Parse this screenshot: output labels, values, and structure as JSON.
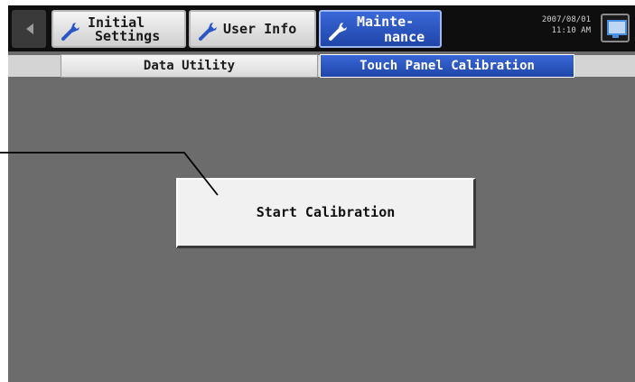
{
  "toolbar": {
    "back_icon": "back-arrow-icon",
    "tabs": [
      {
        "id": "initial",
        "line1": "Initial",
        "line2": "Settings",
        "icon": "wrench-icon",
        "active": false
      },
      {
        "id": "user",
        "label": "User Info",
        "icon": "wrench-icon",
        "active": false
      },
      {
        "id": "maintenance",
        "line1": "Mainte-",
        "line2": "nance",
        "icon": "wrench-icon",
        "active": true
      }
    ],
    "date": "2007/08/01",
    "time": "11:10 AM",
    "monitor_icon": "monitor-icon"
  },
  "subtabs": [
    {
      "label": "Data Utility",
      "active": false
    },
    {
      "label": "Touch Panel Calibration",
      "active": true
    }
  ],
  "main": {
    "start_button_label": "Start Calibration"
  },
  "colors": {
    "active_tab": "#2a55c4",
    "background": "#6c6c6c",
    "toolbar": "#0e0e0e"
  }
}
